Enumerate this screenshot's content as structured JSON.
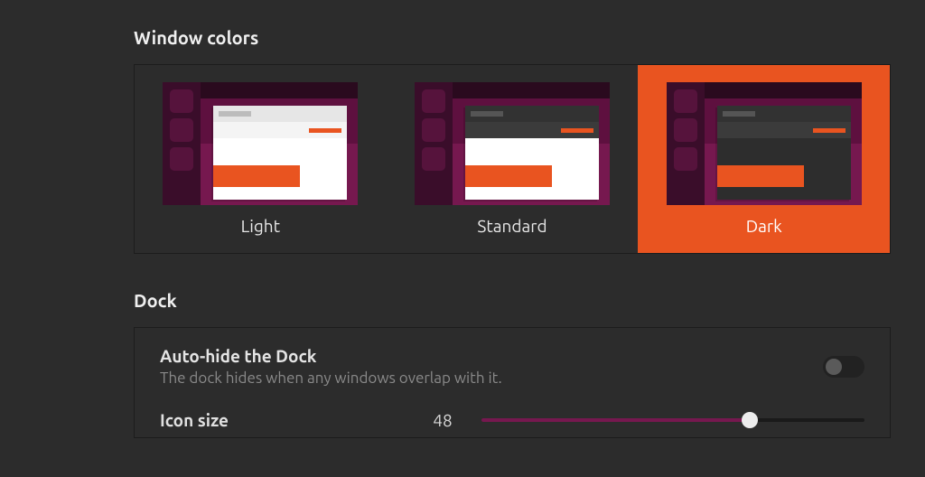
{
  "window_colors": {
    "title": "Window colors",
    "options": [
      {
        "label": "Light",
        "selected": false
      },
      {
        "label": "Standard",
        "selected": false
      },
      {
        "label": "Dark",
        "selected": true
      }
    ]
  },
  "dock": {
    "title": "Dock",
    "autohide": {
      "label": "Auto-hide the Dock",
      "description": "The dock hides when any windows overlap with it.",
      "enabled": false
    },
    "icon_size": {
      "label": "Icon size",
      "value": "48"
    }
  },
  "colors": {
    "accent": "#e95420",
    "aubergine_dark": "#5e103f",
    "aubergine_light": "#76184f"
  }
}
